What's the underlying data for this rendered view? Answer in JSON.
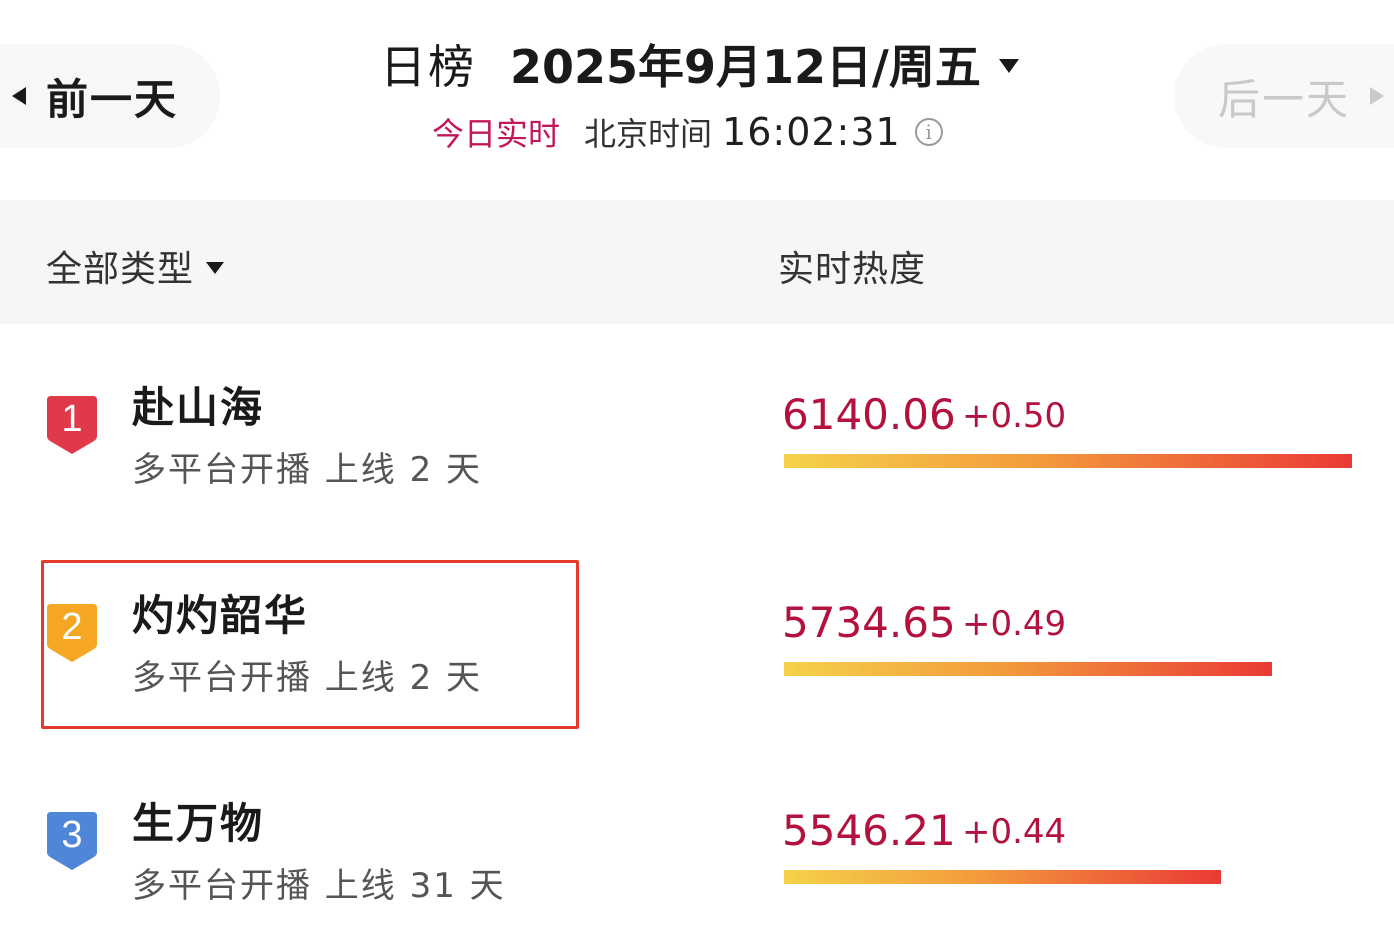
{
  "header": {
    "prev_label": "前一天",
    "next_label": "后一天",
    "board_label": "日榜",
    "date_text": "2025年9月12日/周五",
    "realtime_label": "今日实时",
    "timezone_label": "北京时间",
    "clock": "16:02:31",
    "info_glyph": "i"
  },
  "columns": {
    "type_filter": "全部类型",
    "heat": "实时热度"
  },
  "rows": [
    {
      "rank": "1",
      "title": "赴山海",
      "meta": "多平台开播 上线 2 天",
      "heat": "6140.06",
      "delta": "+0.50",
      "bar_fraction": 1.0,
      "badge_color": "#e03a4a"
    },
    {
      "rank": "2",
      "title": "灼灼韶华",
      "meta": "多平台开播 上线 2 天",
      "heat": "5734.65",
      "delta": "+0.49",
      "bar_fraction": 0.86,
      "badge_color": "#f5a623"
    },
    {
      "rank": "3",
      "title": "生万物",
      "meta": "多平台开播 上线 31 天",
      "heat": "5546.21",
      "delta": "+0.44",
      "bar_fraction": 0.77,
      "badge_color": "#4f86d8"
    }
  ],
  "colors": {
    "accent_red": "#b3123e",
    "realtime_pink": "#c2185b",
    "highlight_border": "#e23a2c"
  }
}
